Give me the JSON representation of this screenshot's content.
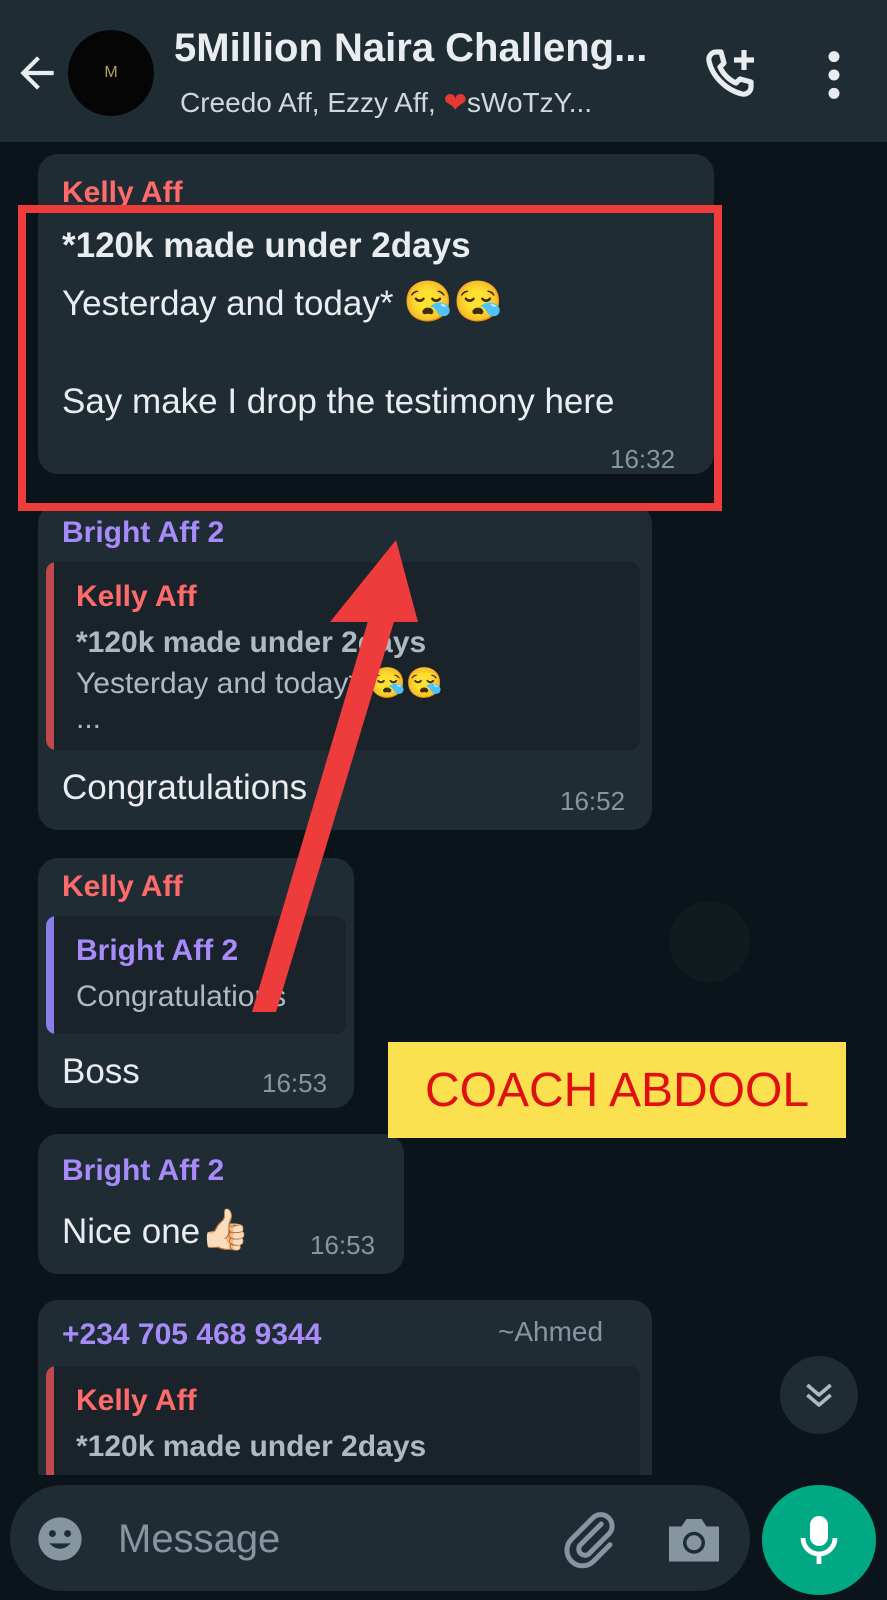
{
  "header": {
    "title": "5Million Naira Challeng...",
    "avatar_text": "M",
    "subtitle_part1": "Creedo Aff,  Ezzy Aff, ",
    "subtitle_part2": "sWoTzY..."
  },
  "messages": [
    {
      "sender": "Kelly Aff",
      "line1": "*120k made under 2days",
      "line2": "Yesterday and today* ",
      "line2_emoji": "😪😪",
      "line3": "Say make I drop the testimony here",
      "time": "16:32"
    },
    {
      "sender": "Bright Aff 2",
      "quote": {
        "sender": "Kelly Aff",
        "line1": "*120k made under 2days",
        "line2": "Yesterday and today* ",
        "line2_emoji": "😪😪",
        "line3": "..."
      },
      "text": "Congratulations",
      "time": "16:52"
    },
    {
      "sender": "Kelly Aff",
      "quote": {
        "sender": "Bright Aff 2",
        "line1": "Congratulations"
      },
      "text": "Boss",
      "time": "16:53"
    },
    {
      "sender": "Bright Aff 2",
      "text": "Nice one",
      "emoji": "👍🏻",
      "time": "16:53"
    },
    {
      "sender": "+234 705 468 9344",
      "sender_alias": "~Ahmed",
      "quote": {
        "sender": "Kelly Aff",
        "line1": "*120k made under 2days"
      }
    }
  ],
  "overlay": {
    "sticker_text": "COACH ABDOOL"
  },
  "composer": {
    "placeholder": "Message"
  },
  "colors": {
    "header_bg": "#1f2c34",
    "chat_bg": "#0b141a",
    "bubble_bg": "#202c33",
    "kelly_color": "#ff6b6b",
    "bright_color": "#a78bfa",
    "mic_bg": "#00a884",
    "highlight_red": "#ee3b3b",
    "sticker_yellow": "#fbe14f"
  },
  "icons": [
    "back-arrow-icon",
    "add-call-icon",
    "more-vert-icon",
    "scroll-down-icon",
    "emoji-icon",
    "attach-icon",
    "camera-icon",
    "mic-icon"
  ]
}
